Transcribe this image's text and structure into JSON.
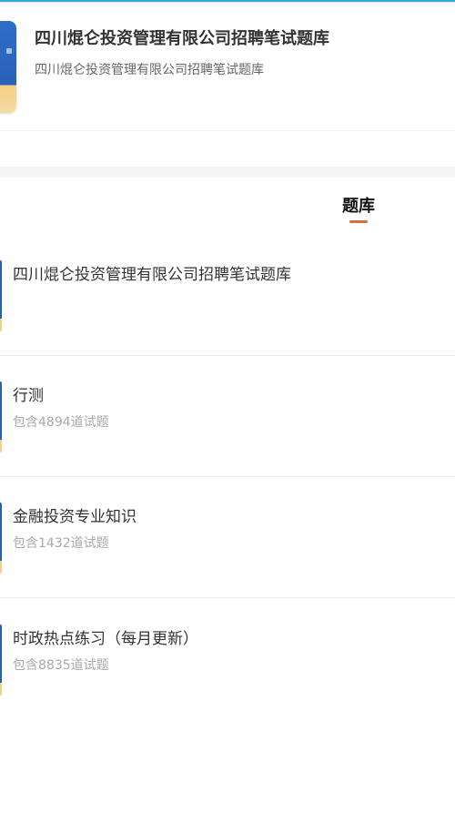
{
  "header": {
    "title": "四川焜仑投资管理有限公司招聘笔试题库",
    "subtitle": "四川焜仑投资管理有限公司招聘笔试题库"
  },
  "tabs": {
    "active_label": "题库"
  },
  "banks": [
    {
      "name": "四川焜仑投资管理有限公司招聘笔试题库",
      "count": ""
    },
    {
      "name": "行测",
      "count": "包含4894道试题"
    },
    {
      "name": "金融投资专业知识",
      "count": "包含1432道试题"
    },
    {
      "name": "时政热点练习（每月更新）",
      "count": "包含8835道试题"
    }
  ],
  "colors": {
    "accent": "#e06b43",
    "top_line": "#3aa3d8",
    "cover_blue": "#2b5fb7",
    "cover_yellow": "#f4cf86"
  }
}
